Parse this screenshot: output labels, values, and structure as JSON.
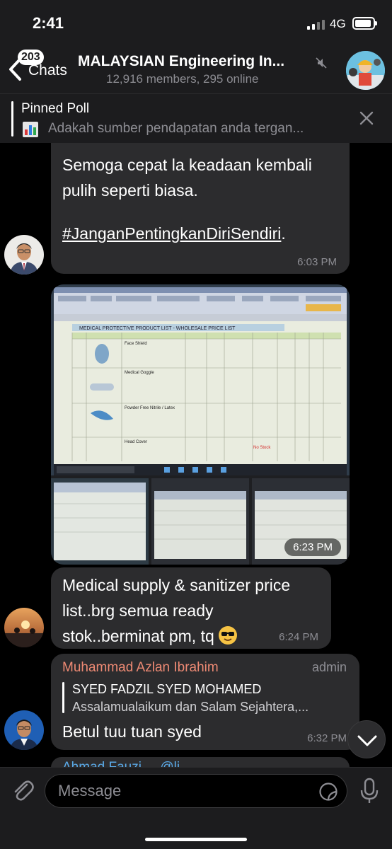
{
  "status_bar": {
    "time": "2:41",
    "network": "4G",
    "battery_level": 0.8
  },
  "header": {
    "back_badge": "203",
    "back_label": "Chats",
    "title": "MALAYSIAN Engineering In...",
    "subtitle": "12,916 members, 295 online"
  },
  "pinned": {
    "title": "Pinned Poll",
    "text": "Adakah sumber pendapatan anda tergan..."
  },
  "messages": [
    {
      "text_line1": "Semoga cepat la keadaan kembali",
      "text_line2": "pulih seperti biasa.",
      "hashtag": "#JanganPentingkanDiriSendiri",
      "trailing": ".",
      "time": "6:03 PM"
    },
    {
      "type": "photo-album",
      "time": "6:23 PM",
      "sheet_title": "MEDICAL PROTECTIVE PRODUCT LIST - WHOLESALE PRICE LIST",
      "rows": [
        "Face Shield",
        "Medical Goggle",
        "Powder Free Nitrile / Latex",
        "Head Cover"
      ]
    },
    {
      "line1": "Medical supply & sanitizer price",
      "line2": "list..brg semua ready",
      "line3": "stok..berminat pm, tq",
      "time": "6:24 PM"
    },
    {
      "sender": "Muhammad Azlan Ibrahim",
      "role": "admin",
      "quote_name": "SYED FADZIL SYED MOHAMED",
      "quote_text": "Assalamualaikum dan Salam Sejahtera,...",
      "text": "Betul tuu tuan syed",
      "time": "6:32 PM"
    },
    {
      "peek": "Ahmad Fauzi ... @li..."
    }
  ],
  "input": {
    "placeholder": "Message"
  },
  "colors": {
    "bubble": "#2c2c2e",
    "sender": "#ee8a74",
    "link": "#5aa9e6"
  }
}
